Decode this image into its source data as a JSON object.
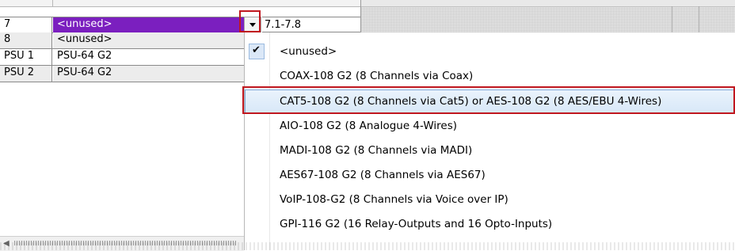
{
  "grid": {
    "rows": [
      {
        "slot": "7",
        "module": "<unused>",
        "selected": true
      },
      {
        "slot": "8",
        "module": "<unused>",
        "selected": false
      },
      {
        "slot": "PSU 1",
        "module": "PSU-64 G2",
        "selected": false
      },
      {
        "slot": "PSU 2",
        "module": "PSU-64 G2",
        "selected": false
      }
    ]
  },
  "editor": {
    "value": "7.1-7.8",
    "dropdown_icon": "chevron-down-icon"
  },
  "menu": {
    "items": [
      {
        "label": "<unused>",
        "checked": true
      },
      {
        "label": "COAX-108 G2 (8 Channels via Coax)",
        "checked": false
      },
      {
        "label": "CAT5-108 G2 (8 Channels via Cat5) or AES-108 G2 (8 AES/EBU 4-Wires)",
        "checked": false,
        "hovered": true
      },
      {
        "label": "AIO-108 G2 (8 Analogue 4-Wires)",
        "checked": false
      },
      {
        "label": "MADI-108 G2 (8 Channels via MADI)",
        "checked": false
      },
      {
        "label": "AES67-108 G2 (8 Channels via AES67)",
        "checked": false
      },
      {
        "label": "VoIP-108-G2 (8 Channels via Voice over IP)",
        "checked": false
      },
      {
        "label": "GPI-116 G2 (16 Relay-Outputs and 16 Opto-Inputs)",
        "checked": false
      }
    ],
    "check_icon": "checkmark-icon"
  },
  "colors": {
    "selection": "#7b1fbf",
    "highlight_box": "#c0171f",
    "hover_border": "#7ea6d6"
  }
}
